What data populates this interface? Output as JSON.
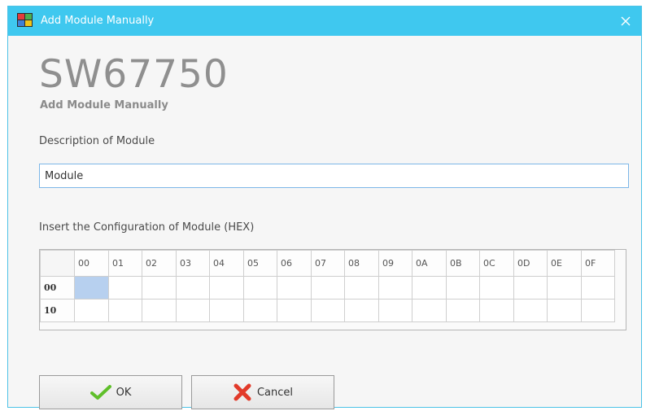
{
  "window": {
    "title": "Add Module Manually",
    "accent_color": "#3fc8ef"
  },
  "header": {
    "product": "SW67750",
    "subtitle": "Add Module Manually"
  },
  "description": {
    "label": "Description of Module",
    "value": "Module"
  },
  "config": {
    "label": "Insert the Configuration of Module (HEX)",
    "columns": [
      "00",
      "01",
      "02",
      "03",
      "04",
      "05",
      "06",
      "07",
      "08",
      "09",
      "0A",
      "0B",
      "0C",
      "0D",
      "0E",
      "0F"
    ],
    "rows": [
      "00",
      "10"
    ],
    "selected_cell": {
      "row": "00",
      "column": "00"
    }
  },
  "buttons": {
    "ok": "OK",
    "cancel": "Cancel"
  }
}
